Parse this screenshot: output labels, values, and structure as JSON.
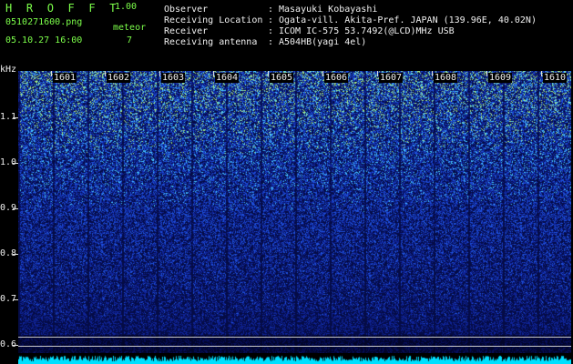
{
  "header": {
    "app_title": "H R O F F T",
    "app_version": "1.00",
    "file_name": "0510271600.png",
    "meteor_label": "meteor",
    "date_time": "05.10.27 16:00",
    "meteor_count": "7"
  },
  "info": {
    "separator": ":",
    "rows": [
      {
        "key": "Observer",
        "value": "Masayuki Kobayashi"
      },
      {
        "key": "Receiving Location",
        "value": "Ogata-vill. Akita-Pref. JAPAN (139.96E, 40.02N)"
      },
      {
        "key": "Receiver",
        "value": "ICOM IC-575 53.7492(@LCD)MHz USB"
      },
      {
        "key": "Receiving antenna",
        "value": "A504HB(yagi 4el)"
      }
    ]
  },
  "spectrogram": {
    "y_unit": "kHz",
    "y_ticks": [
      "1.1",
      "1.0",
      "0.9",
      "0.8",
      "0.7",
      "0.6"
    ],
    "x_ticks": [
      "1601",
      "1602",
      "1603",
      "1604",
      "1605",
      "1606",
      "1607",
      "1608",
      "1609",
      "1610"
    ],
    "colors": {
      "background": "#000000",
      "low": "#0a1450",
      "mid": "#1e46c8",
      "high": "#50c8ff",
      "peak": "#c8ff78",
      "strip": "#00e0ff"
    }
  }
}
